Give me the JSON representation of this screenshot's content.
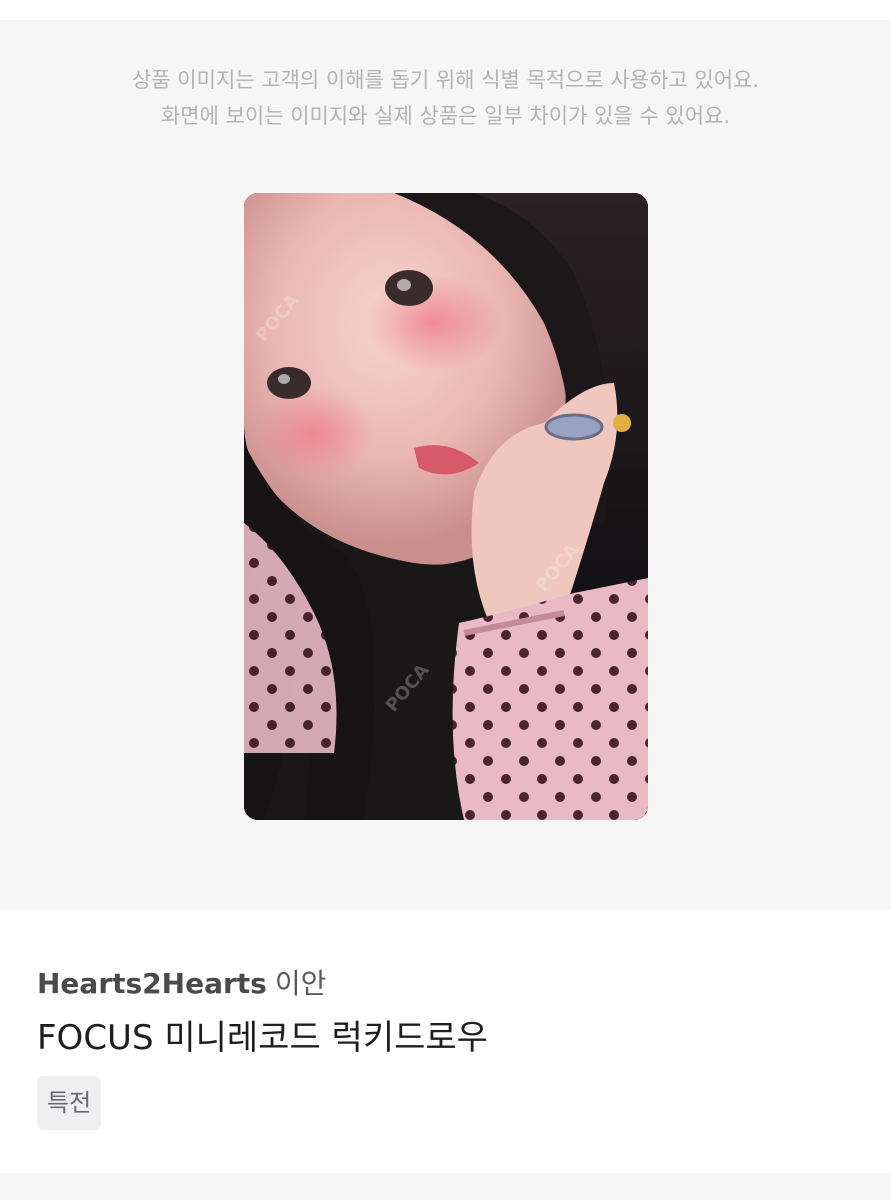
{
  "disclaimer": {
    "line1": "상품 이미지는 고객의 이해를 돕기 위해 식별 목적으로 사용하고 있어요.",
    "line2": "화면에 보이는 이미지와 실제 상품은 일부 차이가 있을 수 있어요."
  },
  "product": {
    "image_alt": "photocard",
    "artist": "Hearts2Hearts",
    "member": "이안",
    "title": "FOCUS 미니레코드 럭키드로우",
    "tag": "특전"
  },
  "colors": {
    "background": "#f6f6f7",
    "disclaimer_text": "#b3b3b6",
    "title_text": "#1e1e20",
    "tag_background": "#efeff1"
  }
}
